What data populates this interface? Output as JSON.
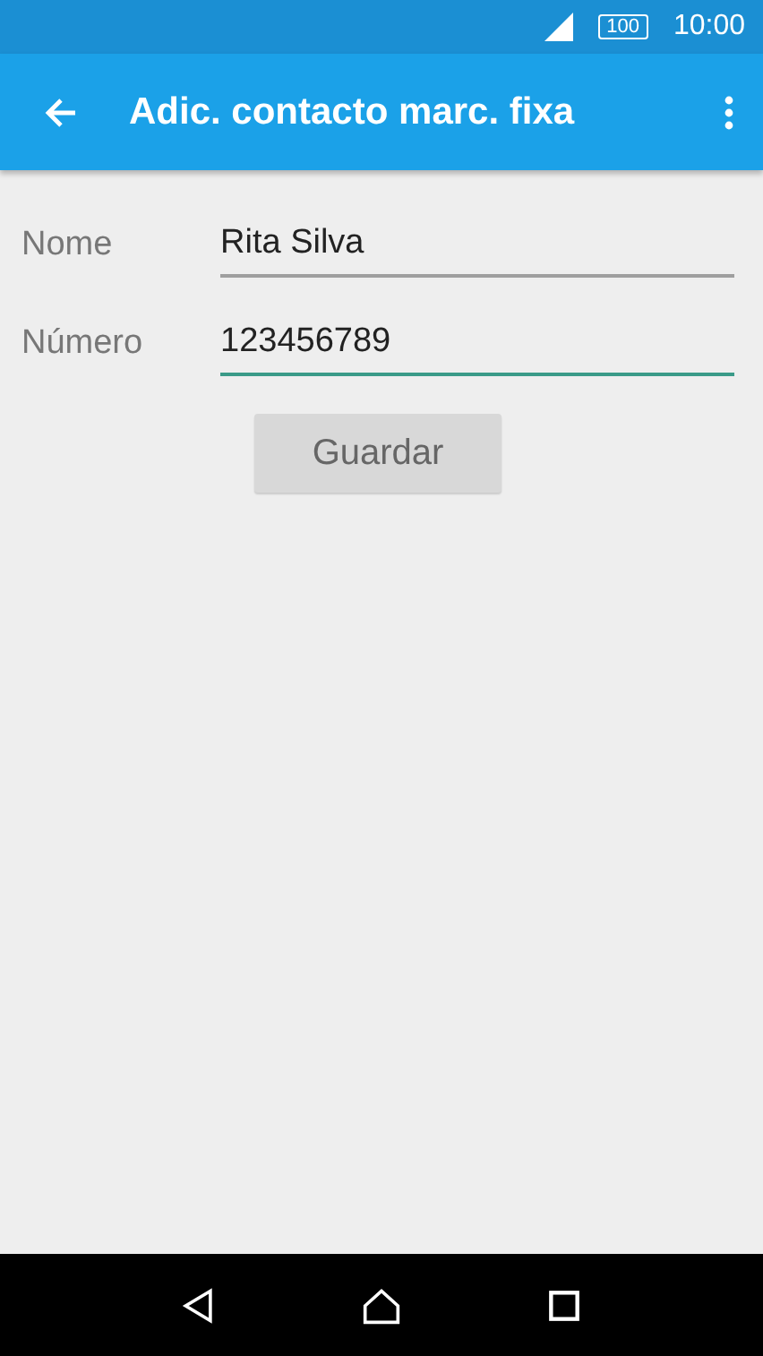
{
  "status_bar": {
    "battery": "100",
    "time": "10:00"
  },
  "app_bar": {
    "title": "Adic. contacto marc. fixa"
  },
  "fields": [
    {
      "label": "Nome",
      "value": "Rita Silva",
      "focused": false
    },
    {
      "label": "Número",
      "value": "123456789",
      "focused": true
    }
  ],
  "button": {
    "label": "Guardar"
  }
}
